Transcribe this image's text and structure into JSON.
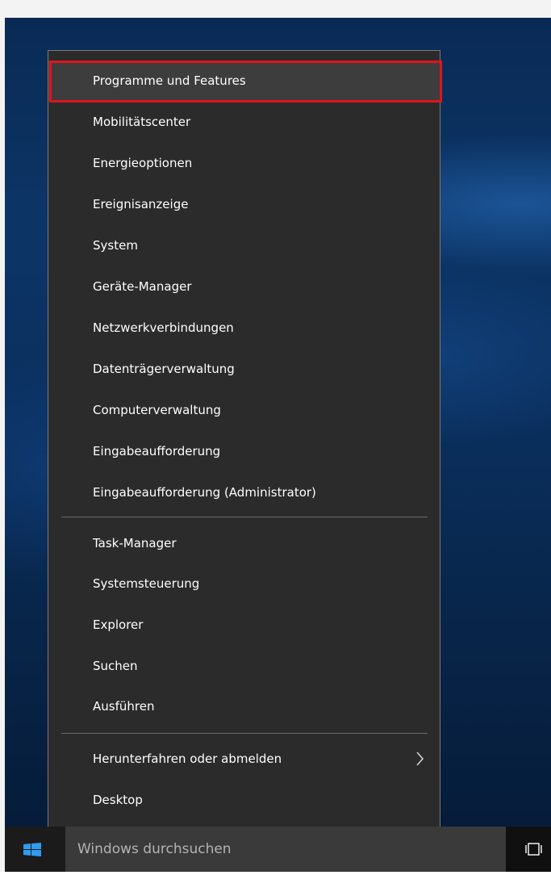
{
  "menu": {
    "items": [
      {
        "label": "Programme und Features"
      },
      {
        "label": "Mobilitätscenter"
      },
      {
        "label": "Energieoptionen"
      },
      {
        "label": "Ereignisanzeige"
      },
      {
        "label": "System"
      },
      {
        "label": "Geräte-Manager"
      },
      {
        "label": "Netzwerkverbindungen"
      },
      {
        "label": "Datenträgerverwaltung"
      },
      {
        "label": "Computerverwaltung"
      },
      {
        "label": "Eingabeaufforderung"
      },
      {
        "label": "Eingabeaufforderung (Administrator)"
      },
      {
        "label": "Task-Manager"
      },
      {
        "label": "Systemsteuerung"
      },
      {
        "label": "Explorer"
      },
      {
        "label": "Suchen"
      },
      {
        "label": "Ausführen"
      },
      {
        "label": "Herunterfahren oder abmelden",
        "icon": "chevron-right-icon"
      },
      {
        "label": "Desktop"
      }
    ],
    "highlighted_item": "Programme und Features",
    "highlight_color": "#e0141e"
  },
  "taskbar": {
    "start_icon": "windows-logo-icon",
    "search_placeholder": "Windows durchsuchen",
    "taskview_icon": "task-view-icon"
  }
}
